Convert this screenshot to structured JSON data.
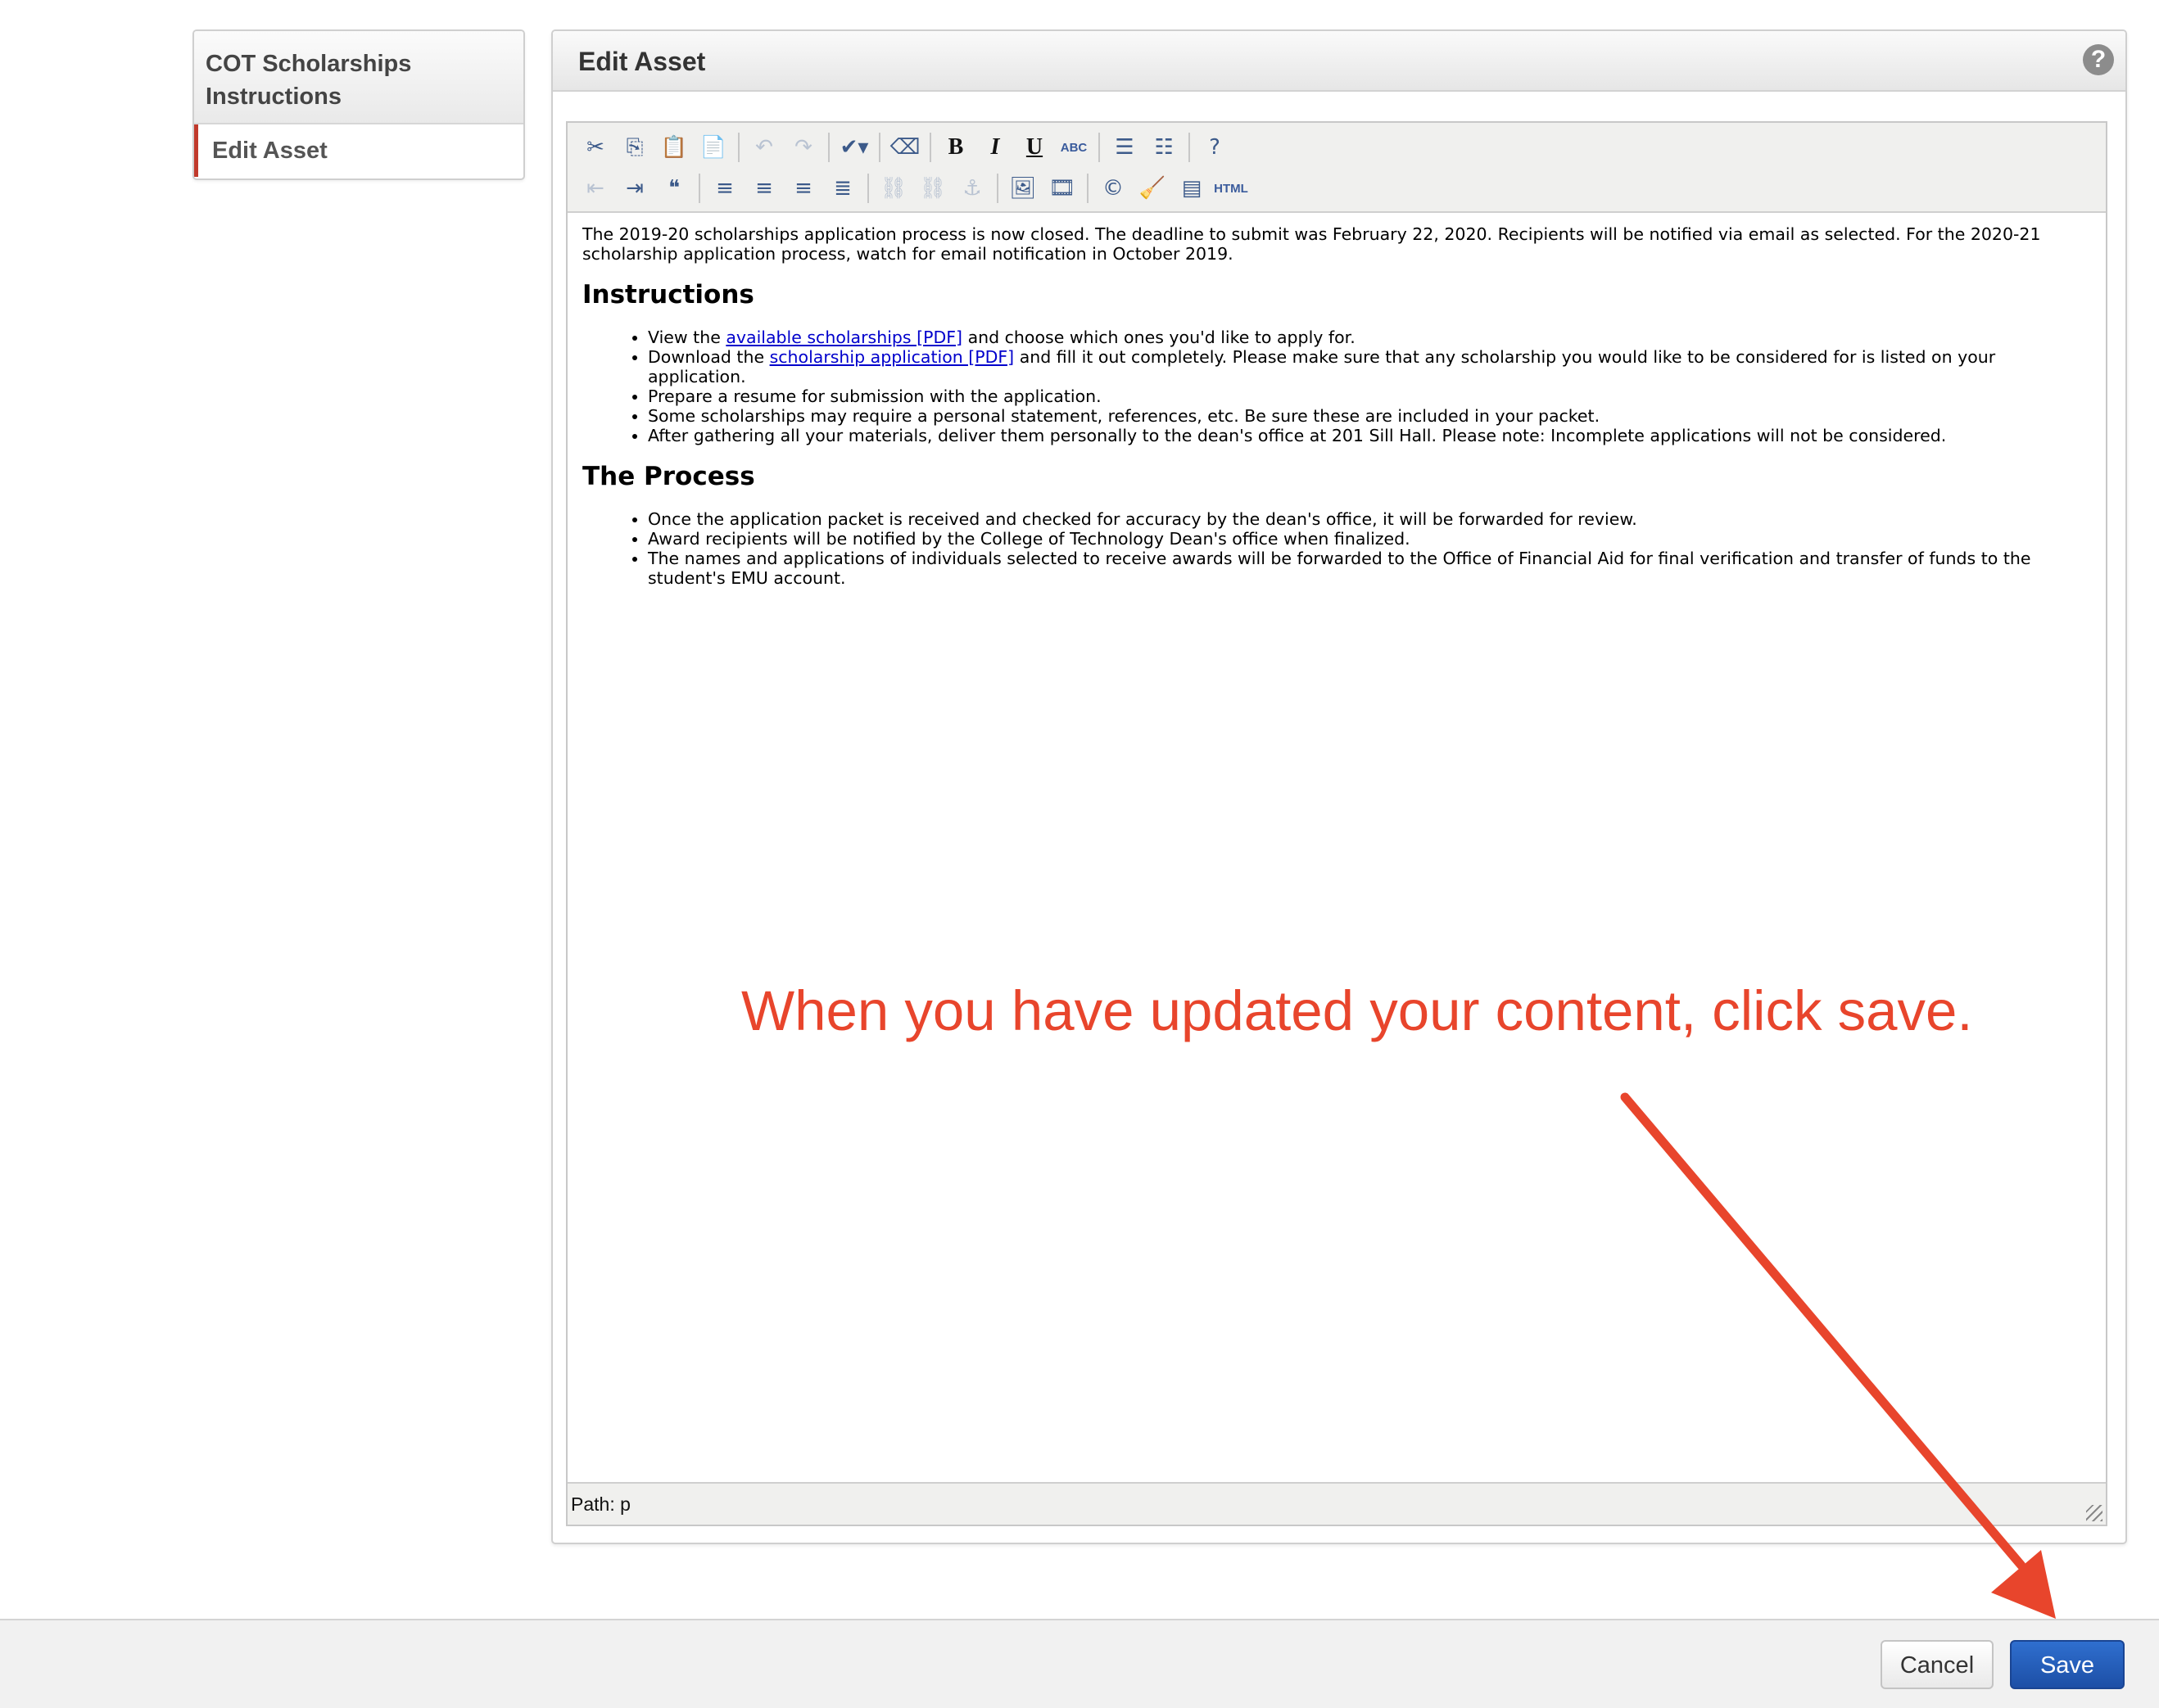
{
  "sidebar": {
    "title": "COT Scholarships Instructions",
    "items": [
      {
        "label": "Edit Asset"
      }
    ]
  },
  "panel": {
    "title": "Edit Asset",
    "help_label": "?"
  },
  "toolbar": {
    "row1": [
      {
        "icon": "cut-icon",
        "glyph": "✂",
        "disabled": false
      },
      {
        "icon": "copy-icon",
        "glyph": "⎘",
        "disabled": false
      },
      {
        "icon": "paste-icon",
        "glyph": "📋",
        "disabled": false
      },
      {
        "icon": "paste-text-icon",
        "glyph": "📄",
        "disabled": false
      },
      {
        "icon": "undo-icon",
        "glyph": "↶",
        "disabled": true
      },
      {
        "icon": "redo-icon",
        "glyph": "↷",
        "disabled": true
      },
      {
        "icon": "spellcheck-icon",
        "glyph": "✔▾",
        "disabled": false
      },
      {
        "icon": "eraser-icon",
        "glyph": "⌫",
        "disabled": false
      },
      {
        "icon": "bold-icon",
        "glyph": "B",
        "disabled": false
      },
      {
        "icon": "italic-icon",
        "glyph": "I",
        "disabled": false
      },
      {
        "icon": "underline-icon",
        "glyph": "U",
        "disabled": false
      },
      {
        "icon": "strikethrough-icon",
        "glyph": "ABC",
        "disabled": false
      },
      {
        "icon": "bullet-list-icon",
        "glyph": "☰",
        "disabled": false
      },
      {
        "icon": "numbered-list-icon",
        "glyph": "☷",
        "disabled": false
      },
      {
        "icon": "help-icon",
        "glyph": "?",
        "disabled": false
      }
    ],
    "row2": [
      {
        "icon": "outdent-icon",
        "glyph": "⇤",
        "disabled": true
      },
      {
        "icon": "indent-icon",
        "glyph": "⇥",
        "disabled": false
      },
      {
        "icon": "blockquote-icon",
        "glyph": "❝",
        "disabled": false
      },
      {
        "icon": "align-left-icon",
        "glyph": "≡",
        "disabled": false
      },
      {
        "icon": "align-center-icon",
        "glyph": "≡",
        "disabled": false
      },
      {
        "icon": "align-right-icon",
        "glyph": "≡",
        "disabled": false
      },
      {
        "icon": "align-justify-icon",
        "glyph": "≣",
        "disabled": false
      },
      {
        "icon": "link-icon",
        "glyph": "⛓",
        "disabled": true
      },
      {
        "icon": "unlink-icon",
        "glyph": "⛓",
        "disabled": true
      },
      {
        "icon": "anchor-icon",
        "glyph": "⚓",
        "disabled": true
      },
      {
        "icon": "image-icon",
        "glyph": "🖼",
        "disabled": false
      },
      {
        "icon": "media-icon",
        "glyph": "🎞",
        "disabled": false
      },
      {
        "icon": "copyright-icon",
        "glyph": "©",
        "disabled": false
      },
      {
        "icon": "cleanup-icon",
        "glyph": "🧹",
        "disabled": false
      },
      {
        "icon": "template-icon",
        "glyph": "▤",
        "disabled": false
      },
      {
        "icon": "html-icon",
        "glyph": "HTML",
        "disabled": false
      }
    ]
  },
  "document": {
    "intro": "The 2019-20 scholarships application process is now closed. The deadline to submit was February 22, 2020. Recipients will be notified via email as selected. For the 2020-21 scholarship application process, watch for email notification in October 2019.",
    "instructions_heading": "Instructions",
    "inst1_pre": "View the ",
    "inst1_link": "available scholarships [PDF]",
    "inst1_post": " and choose which ones you'd like to apply for.",
    "inst2_pre": "Download the ",
    "inst2_link": "scholarship application [PDF]",
    "inst2_post": " and fill it out completely. Please make sure that any scholarship you would like to be considered for is listed on your application.",
    "inst3": "Prepare a resume for submission with the application.",
    "inst4": "Some scholarships may require a personal statement, references, etc. Be sure these are included in your packet.",
    "inst5": "After gathering all your materials, deliver them personally to the dean's office at 201 Sill Hall. Please note: Incomplete applications will not be considered.",
    "process_heading": "The Process",
    "proc1": "Once the application packet is received and checked for accuracy by the dean's office, it will be forwarded for review.",
    "proc2": "Award recipients will be notified by the College of Technology Dean's office when finalized.",
    "proc3": "The names and applications of individuals selected to receive awards will be forwarded to the Office of Financial Aid for final verification and transfer of funds to the student's EMU account."
  },
  "statusbar": {
    "path": "Path: p"
  },
  "annotation": {
    "text": "When you have updated your content, click save.",
    "color": "#e8452c"
  },
  "footer": {
    "cancel_label": "Cancel",
    "save_label": "Save"
  }
}
